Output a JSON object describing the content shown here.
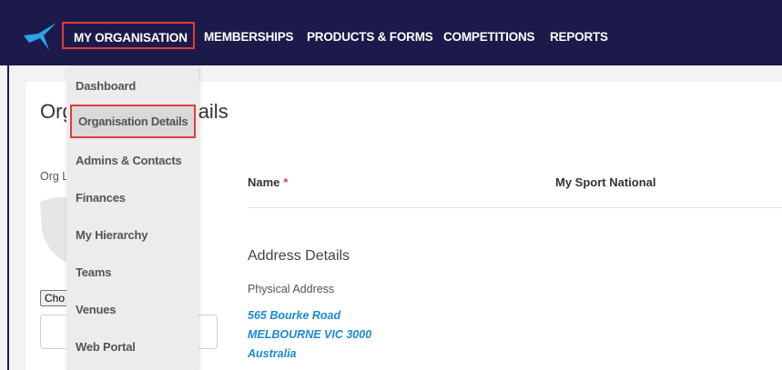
{
  "nav": {
    "items": [
      {
        "label": "MY ORGANISATION"
      },
      {
        "label": "MEMBERSHIPS"
      },
      {
        "label": "PRODUCTS & FORMS"
      },
      {
        "label": "COMPETITIONS"
      },
      {
        "label": "REPORTS"
      }
    ]
  },
  "dropdown": {
    "items": [
      {
        "label": "Dashboard"
      },
      {
        "label": "Organisation Details"
      },
      {
        "label": "Admins & Contacts"
      },
      {
        "label": "Finances"
      },
      {
        "label": "My Hierarchy"
      },
      {
        "label": "Teams"
      },
      {
        "label": "Venues"
      },
      {
        "label": "Web Portal"
      }
    ]
  },
  "page": {
    "title_visible": "Org",
    "title_tail": "ails",
    "org_logo_label": "Org L",
    "choose_button": "Cho"
  },
  "details": {
    "name_label": "Name",
    "required_marker": "*",
    "name_value": "My Sport National",
    "address_section_title": "Address Details",
    "physical_address_label": "Physical Address",
    "address_lines": [
      "565 Bourke Road",
      "MELBOURNE VIC 3000",
      "Australia"
    ]
  },
  "colors": {
    "nav_background": "#1c1a4b",
    "highlight_border": "#e53b3b",
    "link": "#1a8ad6",
    "logo": "#2aa4e6"
  }
}
